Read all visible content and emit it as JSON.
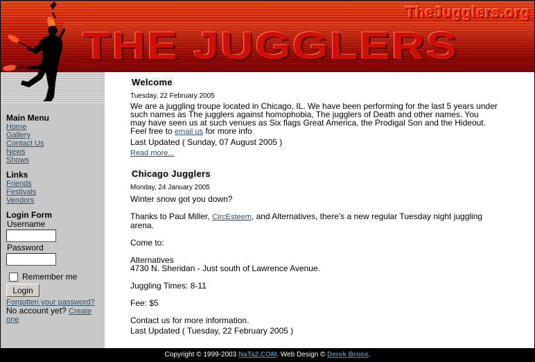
{
  "header": {
    "site_url": "TheJugglers.org",
    "title": "THE JUGGLERS"
  },
  "sidebar": {
    "main_menu": {
      "title": "Main Menu",
      "items": [
        "Home",
        "Gallery",
        "Contact Us",
        "News",
        "Shows"
      ]
    },
    "links": {
      "title": "Links",
      "items": [
        "Friends",
        "Festivals",
        "Vendors"
      ]
    },
    "login": {
      "title": "Login Form",
      "username_label": "Username",
      "username_value": "",
      "password_label": "Password",
      "password_value": "",
      "remember_label": "Remember me",
      "login_button": "Login",
      "forgot_link": "Forgotten your password?",
      "no_account_text": "No account yet?",
      "create_link_1": "Create",
      "create_link_2": "one"
    }
  },
  "articles": [
    {
      "title": "Welcome",
      "date": "Tuesday, 22 February 2005",
      "body_lines": [
        "We are a juggling troupe located in Chicago, IL. We have been performing for the last 5 years under",
        "such names as The jugglers against homophobia, The jugglers of Death and other names. You",
        "may have seen us at such venues as Six flags Great America, the Prodigal Son and the Hideout."
      ],
      "feel_free_prefix": "Feel free to",
      "email_link": "email us",
      "feel_free_suffix": "for more info",
      "last_updated": "Last Updated ( Sunday, 07 August 2005 )",
      "read_more": "Read more..."
    },
    {
      "title": "Chicago Jugglers",
      "date": "Monday, 24 January 2005",
      "intro": "Winter snow got you down?",
      "thanks_prefix": "Thanks to Paul Miller,",
      "thanks_link": "CircEsteem",
      "thanks_suffix": ", and Alternatives, there's a new regular Tuesday night juggling",
      "thanks_line2": "arena.",
      "come_to": "Come to:",
      "venue_name": "Alternatives",
      "venue_address": "4730 N. Sheridan  - Just south of Lawrence Avenue.",
      "times": "Juggling Times:  8-11",
      "fee": "Fee:  $5",
      "contact": "Contact us for more information.",
      "last_updated": "Last Updated ( Tuesday, 22 February 2005 )"
    }
  ],
  "footer": {
    "copyright": "Copyright © 1999-2003",
    "nata2_link": "NaTa2.COM",
    "web_design": ". Web Design ©",
    "designer_link": "Derek Broox",
    "end": "."
  },
  "colors": {
    "banner_red": "#e02a10",
    "link": "#2a4f6a",
    "sidebar_bg": "#c8c8c8"
  },
  "icons": {
    "juggler_logo": "juggler-silhouette-icon"
  }
}
